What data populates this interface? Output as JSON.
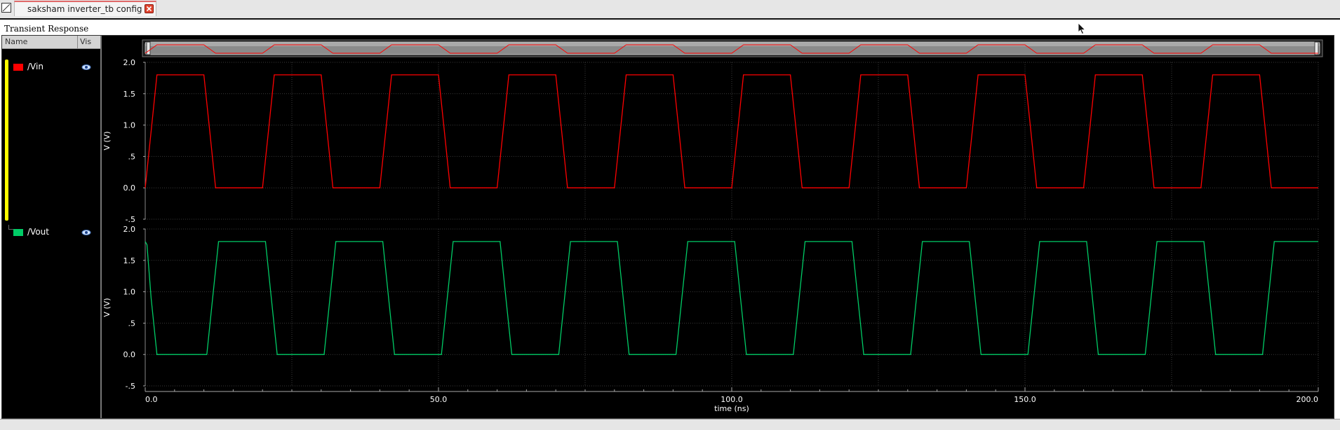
{
  "tab": {
    "title": "saksham inverter_tb config"
  },
  "window": {
    "title": "Transient Response"
  },
  "legend": {
    "name_header": "Name",
    "vis_header": "Vis",
    "signals": [
      {
        "name": "/Vin",
        "color": "#ff0000",
        "icon": "eye-icon"
      },
      {
        "name": "/Vout",
        "color": "#00cc66",
        "icon": "eye-icon"
      }
    ]
  },
  "chart_data": [
    {
      "type": "line",
      "series": [
        {
          "name": "/Vin",
          "color": "#ff0000",
          "x": [
            0,
            1,
            2,
            10,
            11,
            12,
            20,
            21,
            22,
            30,
            31,
            32,
            40,
            41,
            42,
            50,
            51,
            52,
            60,
            61,
            62,
            70,
            71,
            72,
            80,
            81,
            82,
            90,
            91,
            92,
            100,
            101,
            102,
            110,
            111,
            112,
            120,
            121,
            122,
            130,
            131,
            132,
            140,
            141,
            142,
            150,
            151,
            152,
            160,
            161,
            162,
            170,
            171,
            172,
            180,
            181,
            182,
            190,
            191,
            192,
            200
          ],
          "y": [
            0,
            0.9,
            1.8,
            1.8,
            0.9,
            0,
            0,
            0.9,
            1.8,
            1.8,
            0.9,
            0,
            0,
            0.9,
            1.8,
            1.8,
            0.9,
            0,
            0,
            0.9,
            1.8,
            1.8,
            0.9,
            0,
            0,
            0.9,
            1.8,
            1.8,
            0.9,
            0,
            0,
            0.9,
            1.8,
            1.8,
            0.9,
            0,
            0,
            0.9,
            1.8,
            1.8,
            0.9,
            0,
            0,
            0.9,
            1.8,
            1.8,
            0.9,
            0,
            0,
            0.9,
            1.8,
            1.8,
            0.9,
            0,
            0,
            0.9,
            1.8,
            1.8,
            0.9,
            0,
            0
          ]
        }
      ],
      "ylabel": "V (V)",
      "ylim": [
        -0.5,
        2.0
      ],
      "yticks": [
        "2.0",
        "1.5",
        "1.0",
        ".5",
        "0.0",
        "-.5"
      ],
      "xlim": [
        0,
        200
      ],
      "grid": true
    },
    {
      "type": "line",
      "series": [
        {
          "name": "/Vout",
          "color": "#00cc66",
          "x": [
            0,
            0.3,
            1,
            2,
            10.5,
            11.5,
            12.5,
            20.5,
            21.5,
            22.5,
            30.5,
            31.5,
            32.5,
            40.5,
            41.5,
            42.5,
            50.5,
            51.5,
            52.5,
            60.5,
            61.5,
            62.5,
            70.5,
            71.5,
            72.5,
            80.5,
            81.5,
            82.5,
            90.5,
            91.5,
            92.5,
            100.5,
            101.5,
            102.5,
            110.5,
            111.5,
            112.5,
            120.5,
            121.5,
            122.5,
            130.5,
            131.5,
            132.5,
            140.5,
            141.5,
            142.5,
            150.5,
            151.5,
            152.5,
            160.5,
            161.5,
            162.5,
            170.5,
            171.5,
            172.5,
            180.5,
            181.5,
            182.5,
            190.5,
            191.5,
            192.5,
            200
          ],
          "y": [
            1.8,
            1.75,
            0.9,
            0,
            0,
            0.9,
            1.8,
            1.8,
            0.9,
            0,
            0,
            0.9,
            1.8,
            1.8,
            0.9,
            0,
            0,
            0.9,
            1.8,
            1.8,
            0.9,
            0,
            0,
            0.9,
            1.8,
            1.8,
            0.9,
            0,
            0,
            0.9,
            1.8,
            1.8,
            0.9,
            0,
            0,
            0.9,
            1.8,
            1.8,
            0.9,
            0,
            0,
            0.9,
            1.8,
            1.8,
            0.9,
            0,
            0,
            0.9,
            1.8,
            1.8,
            0.9,
            0,
            0,
            0.9,
            1.8,
            1.8,
            0.9,
            0,
            0,
            0.9,
            1.8,
            1.8
          ]
        }
      ],
      "ylabel": "V (V)",
      "ylim": [
        -0.5,
        2.0
      ],
      "yticks": [
        "2.0",
        "1.5",
        "1.0",
        ".5",
        "0.0",
        "-.5"
      ],
      "xlim": [
        0,
        200
      ],
      "xticks": [
        "0.0",
        "50.0",
        "100.0",
        "150.0",
        "200.0"
      ],
      "xlabel": "time (ns)",
      "grid": true
    }
  ],
  "colors": {
    "plot_bg": "#000000",
    "grid": "#3a3a3a",
    "axis_text": "#ffffff"
  }
}
